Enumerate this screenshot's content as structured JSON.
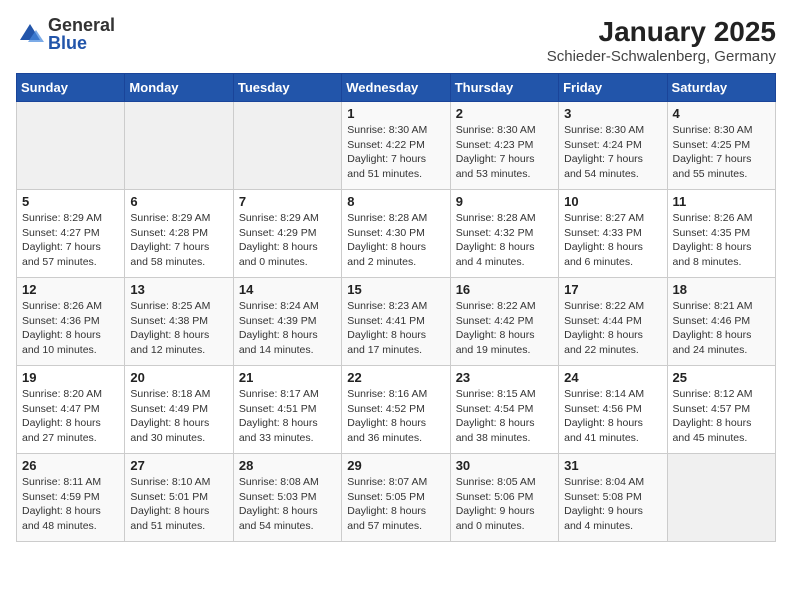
{
  "logo": {
    "general": "General",
    "blue": "Blue"
  },
  "title": "January 2025",
  "subtitle": "Schieder-Schwalenberg, Germany",
  "days_of_week": [
    "Sunday",
    "Monday",
    "Tuesday",
    "Wednesday",
    "Thursday",
    "Friday",
    "Saturday"
  ],
  "weeks": [
    [
      {
        "day": "",
        "info": ""
      },
      {
        "day": "",
        "info": ""
      },
      {
        "day": "",
        "info": ""
      },
      {
        "day": "1",
        "info": "Sunrise: 8:30 AM\nSunset: 4:22 PM\nDaylight: 7 hours\nand 51 minutes."
      },
      {
        "day": "2",
        "info": "Sunrise: 8:30 AM\nSunset: 4:23 PM\nDaylight: 7 hours\nand 53 minutes."
      },
      {
        "day": "3",
        "info": "Sunrise: 8:30 AM\nSunset: 4:24 PM\nDaylight: 7 hours\nand 54 minutes."
      },
      {
        "day": "4",
        "info": "Sunrise: 8:30 AM\nSunset: 4:25 PM\nDaylight: 7 hours\nand 55 minutes."
      }
    ],
    [
      {
        "day": "5",
        "info": "Sunrise: 8:29 AM\nSunset: 4:27 PM\nDaylight: 7 hours\nand 57 minutes."
      },
      {
        "day": "6",
        "info": "Sunrise: 8:29 AM\nSunset: 4:28 PM\nDaylight: 7 hours\nand 58 minutes."
      },
      {
        "day": "7",
        "info": "Sunrise: 8:29 AM\nSunset: 4:29 PM\nDaylight: 8 hours\nand 0 minutes."
      },
      {
        "day": "8",
        "info": "Sunrise: 8:28 AM\nSunset: 4:30 PM\nDaylight: 8 hours\nand 2 minutes."
      },
      {
        "day": "9",
        "info": "Sunrise: 8:28 AM\nSunset: 4:32 PM\nDaylight: 8 hours\nand 4 minutes."
      },
      {
        "day": "10",
        "info": "Sunrise: 8:27 AM\nSunset: 4:33 PM\nDaylight: 8 hours\nand 6 minutes."
      },
      {
        "day": "11",
        "info": "Sunrise: 8:26 AM\nSunset: 4:35 PM\nDaylight: 8 hours\nand 8 minutes."
      }
    ],
    [
      {
        "day": "12",
        "info": "Sunrise: 8:26 AM\nSunset: 4:36 PM\nDaylight: 8 hours\nand 10 minutes."
      },
      {
        "day": "13",
        "info": "Sunrise: 8:25 AM\nSunset: 4:38 PM\nDaylight: 8 hours\nand 12 minutes."
      },
      {
        "day": "14",
        "info": "Sunrise: 8:24 AM\nSunset: 4:39 PM\nDaylight: 8 hours\nand 14 minutes."
      },
      {
        "day": "15",
        "info": "Sunrise: 8:23 AM\nSunset: 4:41 PM\nDaylight: 8 hours\nand 17 minutes."
      },
      {
        "day": "16",
        "info": "Sunrise: 8:22 AM\nSunset: 4:42 PM\nDaylight: 8 hours\nand 19 minutes."
      },
      {
        "day": "17",
        "info": "Sunrise: 8:22 AM\nSunset: 4:44 PM\nDaylight: 8 hours\nand 22 minutes."
      },
      {
        "day": "18",
        "info": "Sunrise: 8:21 AM\nSunset: 4:46 PM\nDaylight: 8 hours\nand 24 minutes."
      }
    ],
    [
      {
        "day": "19",
        "info": "Sunrise: 8:20 AM\nSunset: 4:47 PM\nDaylight: 8 hours\nand 27 minutes."
      },
      {
        "day": "20",
        "info": "Sunrise: 8:18 AM\nSunset: 4:49 PM\nDaylight: 8 hours\nand 30 minutes."
      },
      {
        "day": "21",
        "info": "Sunrise: 8:17 AM\nSunset: 4:51 PM\nDaylight: 8 hours\nand 33 minutes."
      },
      {
        "day": "22",
        "info": "Sunrise: 8:16 AM\nSunset: 4:52 PM\nDaylight: 8 hours\nand 36 minutes."
      },
      {
        "day": "23",
        "info": "Sunrise: 8:15 AM\nSunset: 4:54 PM\nDaylight: 8 hours\nand 38 minutes."
      },
      {
        "day": "24",
        "info": "Sunrise: 8:14 AM\nSunset: 4:56 PM\nDaylight: 8 hours\nand 41 minutes."
      },
      {
        "day": "25",
        "info": "Sunrise: 8:12 AM\nSunset: 4:57 PM\nDaylight: 8 hours\nand 45 minutes."
      }
    ],
    [
      {
        "day": "26",
        "info": "Sunrise: 8:11 AM\nSunset: 4:59 PM\nDaylight: 8 hours\nand 48 minutes."
      },
      {
        "day": "27",
        "info": "Sunrise: 8:10 AM\nSunset: 5:01 PM\nDaylight: 8 hours\nand 51 minutes."
      },
      {
        "day": "28",
        "info": "Sunrise: 8:08 AM\nSunset: 5:03 PM\nDaylight: 8 hours\nand 54 minutes."
      },
      {
        "day": "29",
        "info": "Sunrise: 8:07 AM\nSunset: 5:05 PM\nDaylight: 8 hours\nand 57 minutes."
      },
      {
        "day": "30",
        "info": "Sunrise: 8:05 AM\nSunset: 5:06 PM\nDaylight: 9 hours\nand 0 minutes."
      },
      {
        "day": "31",
        "info": "Sunrise: 8:04 AM\nSunset: 5:08 PM\nDaylight: 9 hours\nand 4 minutes."
      },
      {
        "day": "",
        "info": ""
      }
    ]
  ]
}
